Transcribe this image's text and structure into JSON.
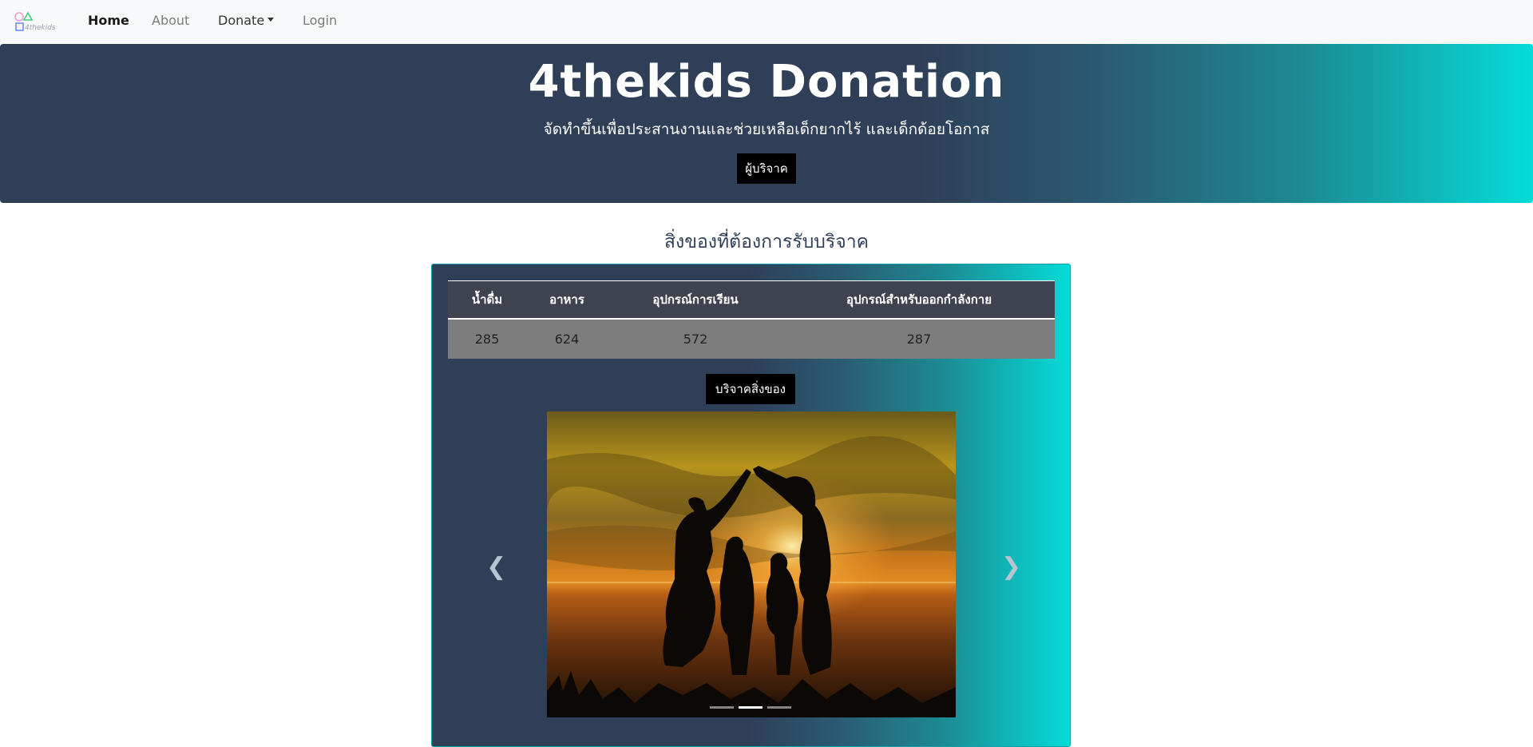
{
  "nav": {
    "logo_text": "4thekids",
    "home": "Home",
    "about": "About",
    "donate": "Donate",
    "login": "Login"
  },
  "hero": {
    "title": "4thekids Donation",
    "subtitle": "จัดทำขึ้นเพื่อประสานงานและช่วยเหลือเด็กยากไร้ และเด็กด้อยโอกาส",
    "donor_button": "ผู้บริจาค"
  },
  "section": {
    "title": "สิ่งของที่ต้องการรับบริจาค",
    "headers": [
      "น้ำดื่ม",
      "อาหาร",
      "อุปกรณ์การเรียน",
      "อุปกรณ์สำหรับออกกำลังกาย"
    ],
    "values": [
      "285",
      "624",
      "572",
      "287"
    ],
    "give_button": "บริจาคสิ่งของ"
  },
  "carousel": {
    "slides": 3,
    "active_slide": 2
  }
}
